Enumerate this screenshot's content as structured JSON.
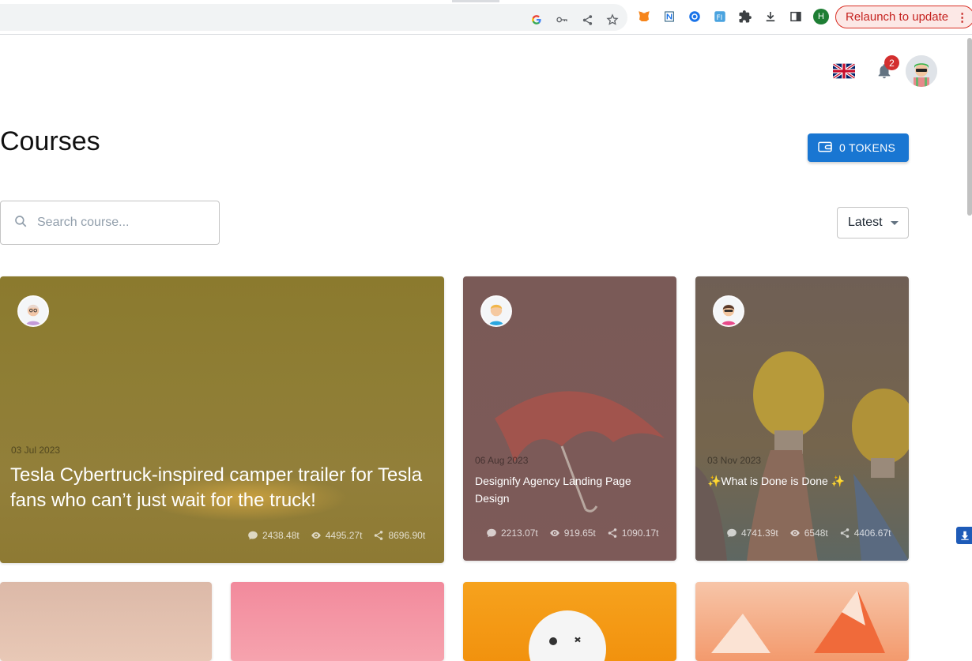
{
  "browser": {
    "relaunch_label": "Relaunch to update",
    "profile_initial": "H",
    "icons": [
      "google-icon",
      "key-icon",
      "share-icon",
      "star-icon",
      "metamask-icon",
      "notion-icon",
      "circle-extension-icon",
      "translate-extension-icon",
      "puzzle-icon",
      "download-icon",
      "sidepanel-icon"
    ]
  },
  "header": {
    "notification_count": "2",
    "language": "English (UK flag)"
  },
  "page": {
    "title": "Courses",
    "tokens_label": "0 TOKENS",
    "search_placeholder": "Search course...",
    "sort_value": "Latest"
  },
  "cards": [
    {
      "date": "03 Jul 2023",
      "title": "Tesla Cybertruck-inspired camper trailer for Tesla fans who can’t just wait for the truck!",
      "comments": "2438.48t",
      "views": "4495.27t",
      "shares": "8696.90t"
    },
    {
      "date": "06 Aug 2023",
      "title": "Designify Agency Landing Page Design",
      "comments": "2213.07t",
      "views": "919.65t",
      "shares": "1090.17t"
    },
    {
      "date": "03 Nov 2023",
      "title": "✨What is Done is Done ✨",
      "comments": "4741.39t",
      "views": "6548t",
      "shares": "4406.67t"
    }
  ],
  "colors": {
    "primary": "#1976d2",
    "badge": "#d32f2f",
    "relaunch_border": "#d93025"
  }
}
